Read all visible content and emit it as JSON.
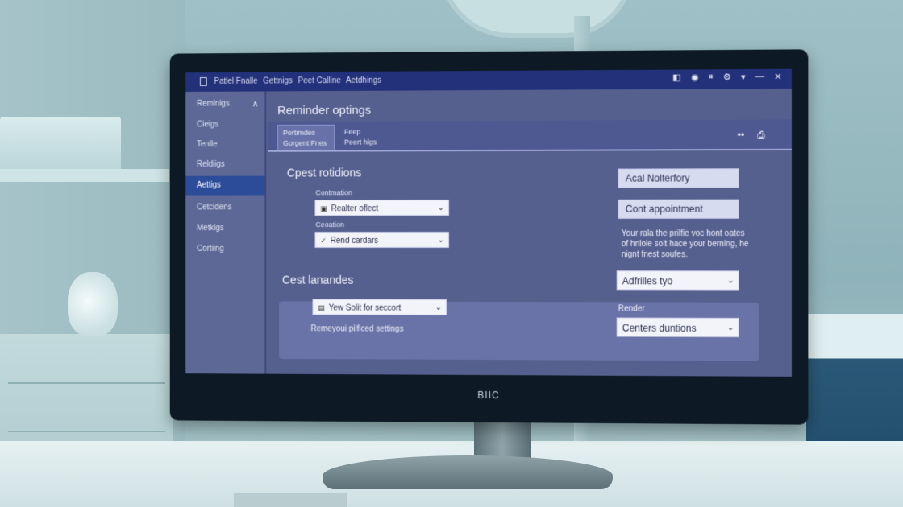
{
  "window": {
    "breadcrumb": [
      "Patlel Fnalle",
      "Gettnigs",
      "Peet Calline",
      "Aetdhings"
    ],
    "controls": [
      "◧",
      "◉",
      "⏸",
      "⚙",
      "▾",
      "—",
      "✕"
    ]
  },
  "sidebar": {
    "items": [
      {
        "label": "Remlnigs"
      },
      {
        "label": "Cieigs"
      },
      {
        "label": "Tenlle"
      },
      {
        "label": "Reldiigs"
      },
      {
        "label": "Aettigs"
      },
      {
        "label": "Cetcidens"
      },
      {
        "label": "Metkigs"
      },
      {
        "label": "Cortiing"
      }
    ],
    "collapse_glyph": "∧"
  },
  "main": {
    "title": "Reminder optings",
    "tabs": [
      {
        "label": "Pertimdes",
        "sub": "Gorgent Fnes"
      },
      {
        "label": "Feep",
        "sub": "Peert hlgs"
      }
    ],
    "header_icons": [
      "••",
      "⎙"
    ]
  },
  "section1": {
    "title": "Cpest rotidions",
    "field1": {
      "label": "Contmation",
      "value": "Realter oflect"
    },
    "field2": {
      "label": "Ceoation",
      "value": "Rend cardars"
    }
  },
  "right_panel": {
    "btn1": "Acal Nolterfory",
    "btn2": "Cont  appointment",
    "note": "Your rala the prilfie voc hont oates of hnlole solt hace your berning, he nignt fnest soufes.",
    "select1": "Adfrilles tyo"
  },
  "section2": {
    "title": "Cest lanandes",
    "select": "Yew Solit for seccort",
    "text": "Remeyoui pilficed settings",
    "render_label": "Render",
    "render_select": "Centers duntions"
  },
  "monitor": {
    "brand": "BIIC"
  }
}
